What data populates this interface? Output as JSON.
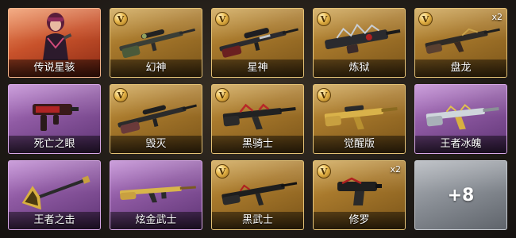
{
  "items": [
    {
      "name": "传说星骇",
      "rarity": "red",
      "badge": "",
      "qty": "",
      "icon": "character-portrait-icon"
    },
    {
      "name": "幻神",
      "rarity": "gold",
      "badge": "V",
      "qty": "",
      "icon": "sniper-rifle-icon"
    },
    {
      "name": "星神",
      "rarity": "gold",
      "badge": "V",
      "qty": "",
      "icon": "sniper-rifle-icon"
    },
    {
      "name": "炼狱",
      "rarity": "gold",
      "badge": "V",
      "qty": "",
      "icon": "machine-gun-icon"
    },
    {
      "name": "盘龙",
      "rarity": "gold",
      "badge": "V",
      "qty": "x2",
      "icon": "assault-rifle-icon"
    },
    {
      "name": "死亡之眼",
      "rarity": "purple",
      "badge": "",
      "qty": "",
      "icon": "smg-icon"
    },
    {
      "name": "毁灭",
      "rarity": "gold",
      "badge": "V",
      "qty": "",
      "icon": "sniper-rifle-icon"
    },
    {
      "name": "黑骑士",
      "rarity": "gold",
      "badge": "V",
      "qty": "",
      "icon": "assault-rifle-icon"
    },
    {
      "name": "觉醒版",
      "rarity": "gold",
      "badge": "V",
      "qty": "",
      "icon": "assault-rifle-icon"
    },
    {
      "name": "王者冰魄",
      "rarity": "purple",
      "badge": "",
      "qty": "",
      "icon": "assault-rifle-icon"
    },
    {
      "name": "王者之击",
      "rarity": "purple",
      "badge": "",
      "qty": "",
      "icon": "melee-axe-icon"
    },
    {
      "name": "炫金武士",
      "rarity": "purple",
      "badge": "",
      "qty": "",
      "icon": "assault-rifle-icon"
    },
    {
      "name": "黑武士",
      "rarity": "gold",
      "badge": "V",
      "qty": "",
      "icon": "assault-rifle-icon"
    },
    {
      "name": "修罗",
      "rarity": "gold",
      "badge": "V",
      "qty": "x2",
      "icon": "pistol-icon"
    }
  ],
  "more": {
    "label": "+8",
    "rarity": "grey"
  },
  "colors": {
    "gold": "#a8792c",
    "purple": "#8f5aa3",
    "red": "#c8522b",
    "grey": "#868b92"
  }
}
